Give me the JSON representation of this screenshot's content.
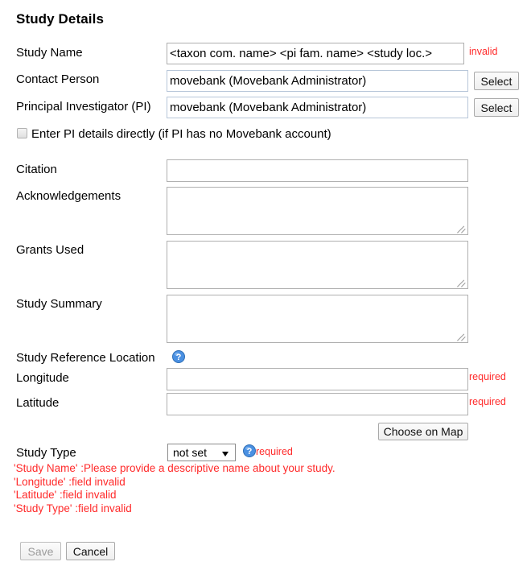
{
  "page": {
    "title": "Study Details"
  },
  "colors": {
    "error_red": "#ff2a2a",
    "input_border_blue": "#b7c6d9",
    "input_border_gray": "#aeaeae",
    "help_icon_blue": "#4a90e2"
  },
  "fields": {
    "study_name": {
      "label": "Study Name",
      "value": "<taxon com. name> <pi fam. name> <study loc.>",
      "placeholder": "",
      "status": "invalid"
    },
    "contact_person": {
      "label": "Contact Person",
      "value": "movebank (Movebank Administrator)",
      "placeholder": "",
      "button": "Select"
    },
    "principal_investigator": {
      "label": "Principal Investigator (PI)",
      "value": "movebank (Movebank Administrator)",
      "placeholder": "",
      "button": "Select"
    },
    "pi_direct_checkbox": {
      "label": "Enter PI details directly (if PI has no Movebank account)",
      "checked": false
    },
    "citation": {
      "label": "Citation",
      "value": "",
      "placeholder": ""
    },
    "acknowledgements": {
      "label": "Acknowledgements",
      "value": "",
      "placeholder": ""
    },
    "grants_used": {
      "label": "Grants Used",
      "value": "",
      "placeholder": ""
    },
    "study_summary": {
      "label": "Study Summary",
      "value": "",
      "placeholder": ""
    },
    "study_reference_location": {
      "label": "Study Reference Location",
      "help_icon": "help-circle-icon"
    },
    "longitude": {
      "label": "Longitude",
      "value": "",
      "placeholder": "",
      "status": "required"
    },
    "latitude": {
      "label": "Latitude",
      "value": "",
      "placeholder": "",
      "status": "required"
    },
    "choose_on_map": {
      "label": "Choose on Map"
    },
    "study_type": {
      "label": "Study Type",
      "selected": "not set",
      "options": [
        "not set"
      ],
      "help_icon": "help-circle-icon",
      "status": "required"
    }
  },
  "errors": [
    "'Study Name' :Please provide a descriptive name about your study.",
    "'Longitude' :field invalid",
    "'Latitude' :field invalid",
    "'Study Type' :field invalid"
  ],
  "actions": {
    "save": "Save",
    "cancel": "Cancel"
  }
}
